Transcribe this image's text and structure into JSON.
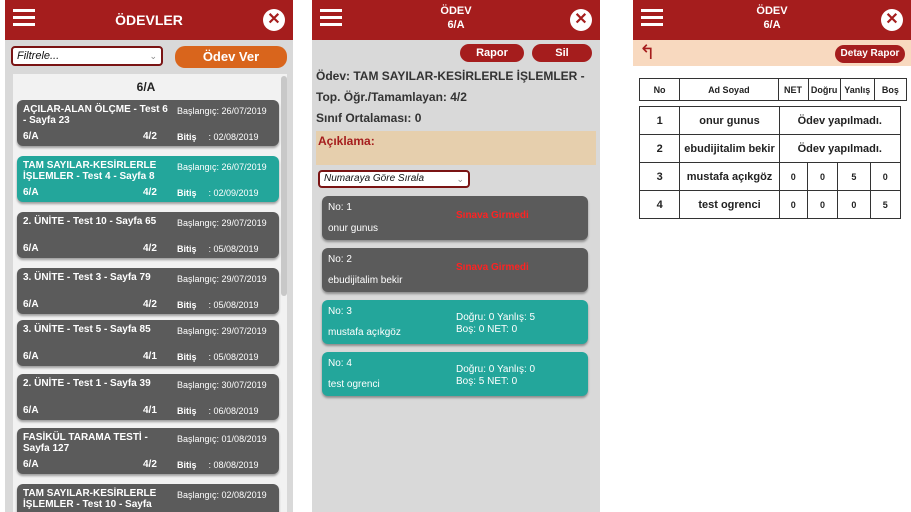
{
  "panel1": {
    "title": "ÖDEVLER",
    "filter_placeholder": "Filtrele...",
    "odev_ver": "Ödev Ver",
    "class_label": "6/A",
    "start_label": "Başlangıç:",
    "end_label": "Bitiş",
    "assignments": [
      {
        "title": "AÇILAR-ALAN ÖLÇME - Test 6 - Sayfa 23",
        "start": "26/07/2019",
        "class": "6/A",
        "ratio": "4/2",
        "end": ": 02/08/2019",
        "color": "gray"
      },
      {
        "title": "TAM SAYILAR-KESİRLERLE İŞLEMLER - Test 4 - Sayfa 8",
        "start": "26/07/2019",
        "class": "6/A",
        "ratio": "4/2",
        "end": ": 02/09/2019",
        "color": "teal"
      },
      {
        "title": "2. ÜNİTE - Test 10 - Sayfa 65",
        "start": "29/07/2019",
        "class": "6/A",
        "ratio": "4/2",
        "end": ": 05/08/2019",
        "color": "gray"
      },
      {
        "title": "3. ÜNİTE - Test 3 - Sayfa 79",
        "start": "29/07/2019",
        "class": "6/A",
        "ratio": "4/2",
        "end": ": 05/08/2019",
        "color": "gray"
      },
      {
        "title": "3. ÜNİTE - Test 5 - Sayfa 85",
        "start": "29/07/2019",
        "class": "6/A",
        "ratio": "4/1",
        "end": ": 05/08/2019",
        "color": "gray"
      },
      {
        "title": "2. ÜNİTE - Test 1 - Sayfa 39",
        "start": "30/07/2019",
        "class": "6/A",
        "ratio": "4/1",
        "end": ": 06/08/2019",
        "color": "gray"
      },
      {
        "title": "FASİKÜL TARAMA TESTİ - Sayfa 127",
        "start": "01/08/2019",
        "class": "6/A",
        "ratio": "4/2",
        "end": ": 08/08/2019",
        "color": "gray"
      },
      {
        "title": "TAM SAYILAR-KESİRLERLE İŞLEMLER - Test 10 - Sayfa",
        "start": "02/08/2019",
        "class": "",
        "ratio": "",
        "end": "",
        "color": "gray"
      }
    ]
  },
  "panel2": {
    "title_line1": "ÖDEV",
    "title_line2": "6/A",
    "rapor": "Rapor",
    "sil": "Sil",
    "odev": "Ödev: TAM SAYILAR-KESİRLERLE İŞLEMLER -",
    "top": "Top. Öğr./Tamamlayan: 4/2",
    "sinif_ort": "Sınıf Ortalaması: 0",
    "aciklama": "Açıklama:",
    "sort": "Numaraya Göre Sırala",
    "students": [
      {
        "no": "No: 1",
        "name": "onur gunus",
        "status": "Sınava Girmedi",
        "line1": "",
        "line2": "",
        "color": "gray"
      },
      {
        "no": "No: 2",
        "name": "ebudijitalim bekir",
        "status": "Sınava Girmedi",
        "line1": "",
        "line2": "",
        "color": "gray"
      },
      {
        "no": "No: 3",
        "name": "mustafa açıkgöz",
        "status": "",
        "line1": "Doğru: 0  Yanlış: 5",
        "line2": "Boş: 0  NET: 0",
        "color": "teal"
      },
      {
        "no": "No: 4",
        "name": "test ogrenci",
        "status": "",
        "line1": "Doğru: 0  Yanlış: 0",
        "line2": "Boş: 5  NET: 0",
        "color": "teal"
      }
    ]
  },
  "panel3": {
    "title_line1": "ÖDEV",
    "title_line2": "6/A",
    "detay": "Detay Rapor",
    "headers": [
      "No",
      "Ad Soyad",
      "NET",
      "Doğru",
      "Yanlış",
      "Boş"
    ],
    "rows": [
      {
        "no": "1",
        "name": "onur gunus",
        "msg": "Ödev yapılmadı."
      },
      {
        "no": "2",
        "name": "ebudijitalim bekir",
        "msg": "Ödev yapılmadı."
      },
      {
        "no": "3",
        "name": "mustafa açıkgöz",
        "net": "0",
        "dogru": "0",
        "yanlis": "5",
        "bos": "0"
      },
      {
        "no": "4",
        "name": "test ogrenci",
        "net": "0",
        "dogru": "0",
        "yanlis": "0",
        "bos": "5"
      }
    ]
  },
  "colors": {
    "header": "#a51d1d",
    "teal": "#23a69b",
    "gray": "#5b5b5b",
    "orange": "#d9651c"
  }
}
